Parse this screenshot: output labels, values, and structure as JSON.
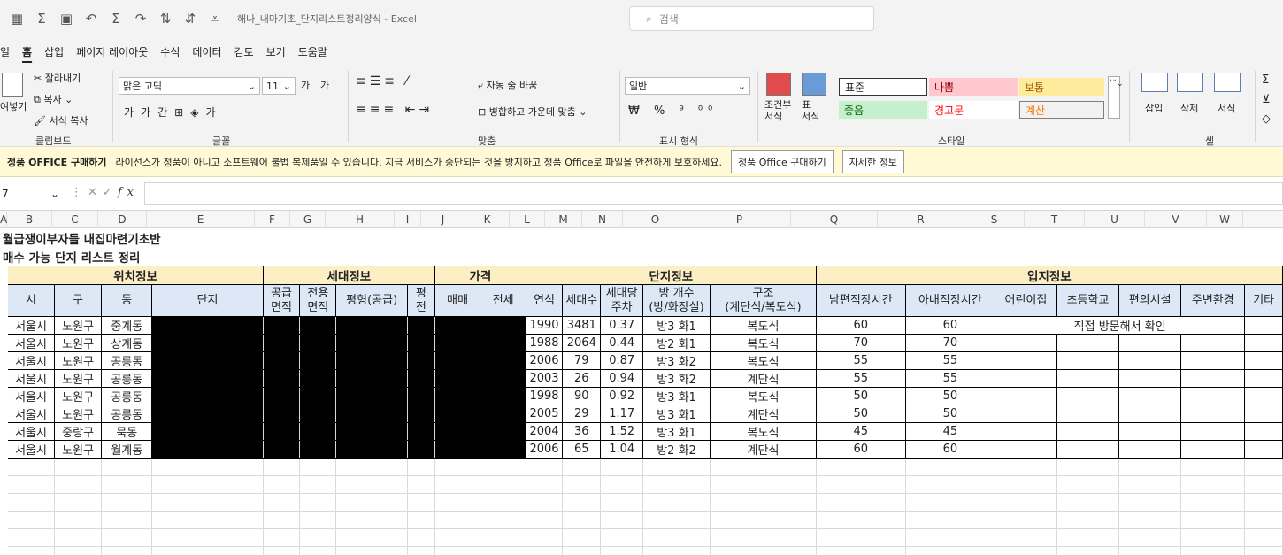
{
  "title_bar": {
    "quick_access_icons": [
      "grid-icon",
      "sum-icon",
      "save-icon",
      "undo-icon",
      "autosum-icon",
      "redo-icon",
      "sort-asc-icon",
      "sort-desc-icon",
      "customize-icon"
    ],
    "doc_title": "해나_내마기초_단지리스트정리양식 - Excel",
    "search_placeholder": "검색"
  },
  "menu": {
    "items": [
      "일",
      "홈",
      "삽입",
      "페이지 레이아웃",
      "수식",
      "데이터",
      "검토",
      "보기",
      "도움말"
    ],
    "active": "홈"
  },
  "ribbon": {
    "clipboard": {
      "cut": "잘라내기",
      "copy": "복사",
      "paste": "여넣기",
      "format_painter": "서식 복사",
      "label": "클립보드"
    },
    "font": {
      "name": "맑은 고딕",
      "size": "11",
      "label": "글꼴",
      "grow": "가",
      "shrink": "가"
    },
    "alignment": {
      "wrap": "자동 줄 바꿈",
      "merge": "병합하고 가운데 맞춤",
      "label": "맞춤"
    },
    "number": {
      "format": "일반",
      "label": "표시 형식"
    },
    "styles": {
      "conditional": "조건부\n서식",
      "table": "표\n서식",
      "cells": [
        "표준",
        "나쁨",
        "보통",
        "좋음",
        "경고문",
        "계산"
      ],
      "label": "스타일"
    },
    "cells": {
      "insert": "삽입",
      "delete": "삭제",
      "format": "서식",
      "label": "셀"
    }
  },
  "message_bar": {
    "title": "정품 OFFICE 구매하기",
    "text": "라이선스가 정품이 아니고 소프트웨어 불법 복제품일 수 있습니다. 지금 서비스가 중단되는 것을 방지하고 정품 Office로 파일을 안전하게 보호하세요.",
    "buy_button": "정품 Office 구매하기",
    "details_button": "자세한 정보"
  },
  "formula_bar": {
    "name_box": "7",
    "fx": "fx",
    "value": ""
  },
  "column_headers": [
    "A",
    "B",
    "C",
    "D",
    "E",
    "F",
    "G",
    "H",
    "I",
    "J",
    "K",
    "L",
    "M",
    "N",
    "O",
    "P",
    "Q",
    "R",
    "S",
    "T",
    "U",
    "V",
    "W"
  ],
  "sheet": {
    "title1": "월급쟁이부자들 내집마련기초반",
    "title2": "매수 가능 단지 리스트 정리",
    "groups": {
      "location": "위치정보",
      "household": "세대정보",
      "price": "가격",
      "complex": "단지정보",
      "site": "입지정보"
    },
    "headers": {
      "si": "시",
      "gu": "구",
      "dong": "동",
      "danji": "단지",
      "supply_area": "공급\n면적",
      "exclusive_area": "전용\n면적",
      "pyeong": "평형(공급)",
      "pyeong2": "평\n전",
      "sale": "매매",
      "jeonse": "전세",
      "year": "연식",
      "households": "세대수",
      "parking": "세대당\n주차",
      "rooms": "방 개수\n(방/화장실)",
      "structure": "구조\n(계단식/복도식)",
      "husband": "남편직장시간",
      "wife": "아내직장시간",
      "daycare": "어린이집",
      "school": "초등학교",
      "convenience": "편의시설",
      "env": "주변환경",
      "etc": "기타"
    },
    "note": "직접 방문해서 확인",
    "rows": [
      {
        "si": "서울시",
        "gu": "노원구",
        "dong": "중계동",
        "year": "1990",
        "households": "3481",
        "parking": "0.37",
        "rooms": "방3 화1",
        "structure": "복도식",
        "husband": "60",
        "wife": "60"
      },
      {
        "si": "서울시",
        "gu": "노원구",
        "dong": "상계동",
        "year": "1988",
        "households": "2064",
        "parking": "0.44",
        "rooms": "방2 화1",
        "structure": "복도식",
        "husband": "70",
        "wife": "70"
      },
      {
        "si": "서울시",
        "gu": "노원구",
        "dong": "공릉동",
        "year": "2006",
        "households": "79",
        "parking": "0.87",
        "rooms": "방3 화2",
        "structure": "복도식",
        "husband": "55",
        "wife": "55"
      },
      {
        "si": "서울시",
        "gu": "노원구",
        "dong": "공릉동",
        "year": "2003",
        "households": "26",
        "parking": "0.94",
        "rooms": "방3 화2",
        "structure": "계단식",
        "husband": "55",
        "wife": "55"
      },
      {
        "si": "서울시",
        "gu": "노원구",
        "dong": "공릉동",
        "year": "1998",
        "households": "90",
        "parking": "0.92",
        "rooms": "방3 화1",
        "structure": "복도식",
        "husband": "50",
        "wife": "50"
      },
      {
        "si": "서울시",
        "gu": "노원구",
        "dong": "공릉동",
        "year": "2005",
        "households": "29",
        "parking": "1.17",
        "rooms": "방3 화1",
        "structure": "계단식",
        "husband": "50",
        "wife": "50"
      },
      {
        "si": "서울시",
        "gu": "중랑구",
        "dong": "묵동",
        "year": "2004",
        "households": "36",
        "parking": "1.52",
        "rooms": "방3 화1",
        "structure": "복도식",
        "husband": "45",
        "wife": "45"
      },
      {
        "si": "서울시",
        "gu": "노원구",
        "dong": "월계동",
        "year": "2006",
        "households": "65",
        "parking": "1.04",
        "rooms": "방2 화2",
        "structure": "계단식",
        "husband": "60",
        "wife": "60"
      }
    ]
  }
}
